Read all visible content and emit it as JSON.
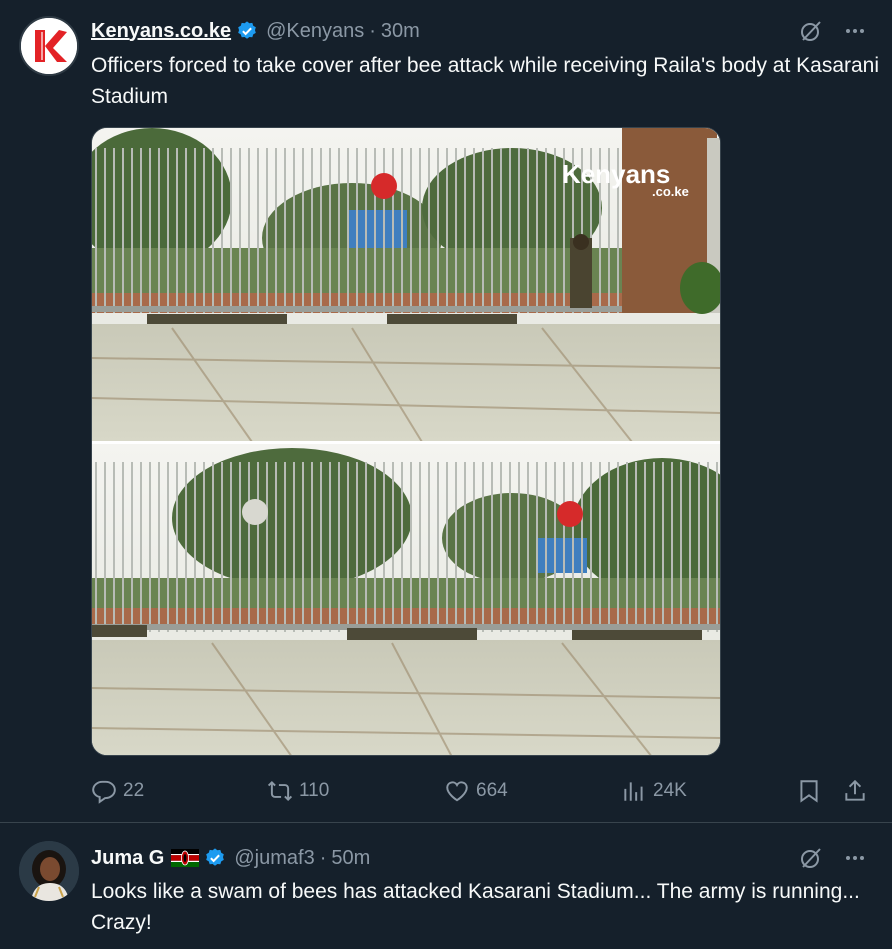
{
  "tweets": [
    {
      "author": "Kenyans.co.ke",
      "handle": "@Kenyans",
      "time": "30m",
      "text": "Officers forced to take cover after bee attack while receiving Raila's body at Kasarani Stadium",
      "media_watermark": "Kenyans",
      "media_watermark_sub": ".co.ke",
      "actions": {
        "replies": "22",
        "reposts": "110",
        "likes": "664",
        "views": "24K"
      }
    },
    {
      "author": "Juma G",
      "flag": "kenya-flag",
      "handle": "@jumaf3",
      "time": "50m",
      "text": "Looks like a swam of bees has attacked Kasarani Stadium... The army is running... Crazy!"
    }
  ],
  "separator": "·",
  "icons": [
    "verified-badge-icon",
    "grok-icon",
    "more-icon",
    "reply-icon",
    "repost-icon",
    "like-icon",
    "views-icon",
    "bookmark-icon",
    "share-icon"
  ],
  "colors": {
    "background": "#15202b",
    "text": "#f7f9f9",
    "secondary_text": "#8b98a5",
    "verified": "#1d9bf0",
    "divider": "#38444d",
    "brand_red": "#e32226"
  }
}
